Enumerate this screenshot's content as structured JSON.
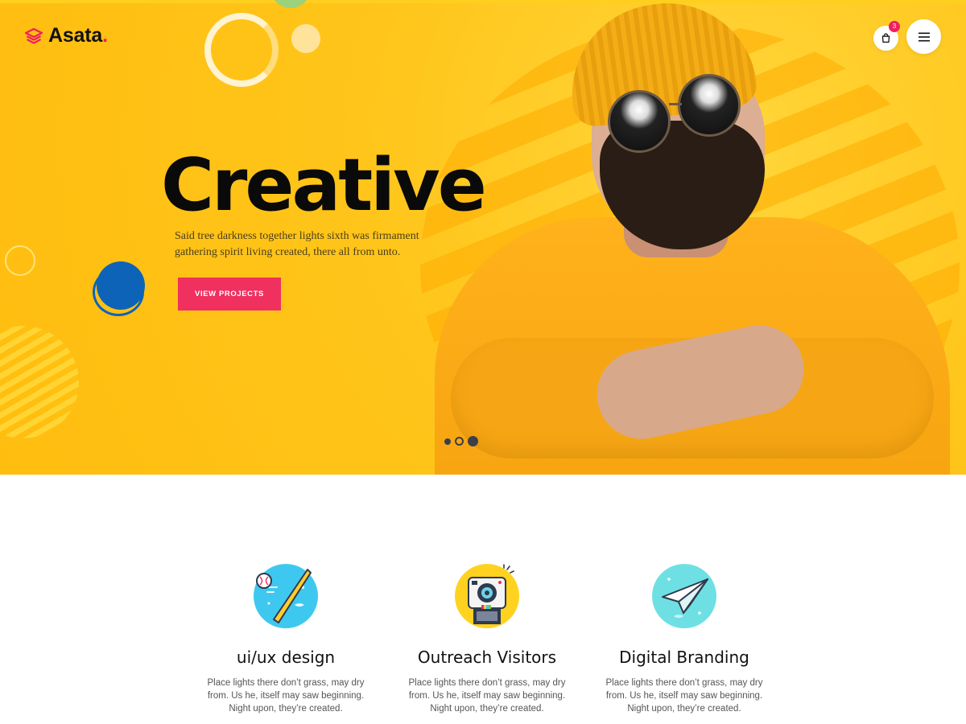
{
  "header": {
    "logo_text": "Asata",
    "logo_dot": ".",
    "cart_count": "3"
  },
  "hero": {
    "title": "Creative",
    "description": "Said tree darkness together lights sixth was firmament gathering spirit living created, there all from unto.",
    "cta_label": "VIEW PROJECTS",
    "slider": {
      "total_slides": 3,
      "active_slide": 3
    }
  },
  "services": [
    {
      "title": "ui/ux design",
      "text": "Place lights there don’t grass, may dry from. Us he, itself may saw beginning. Night upon, they’re created.",
      "icon": "baseball-bat-icon"
    },
    {
      "title": "Outreach Visitors",
      "text": "Place lights there don’t grass, may dry from. Us he, itself may saw beginning. Night upon, they’re created.",
      "icon": "instant-camera-icon"
    },
    {
      "title": "Digital Branding",
      "text": "Place lights there don’t grass, may dry from. Us he, itself may saw beginning. Night upon, they’re created.",
      "icon": "paper-plane-icon"
    }
  ],
  "colors": {
    "hero_yellow": "#ffc51a",
    "accent_pink": "#f0305f",
    "accent_blue": "#0d63b8",
    "text_dark": "#0a0a0a"
  }
}
